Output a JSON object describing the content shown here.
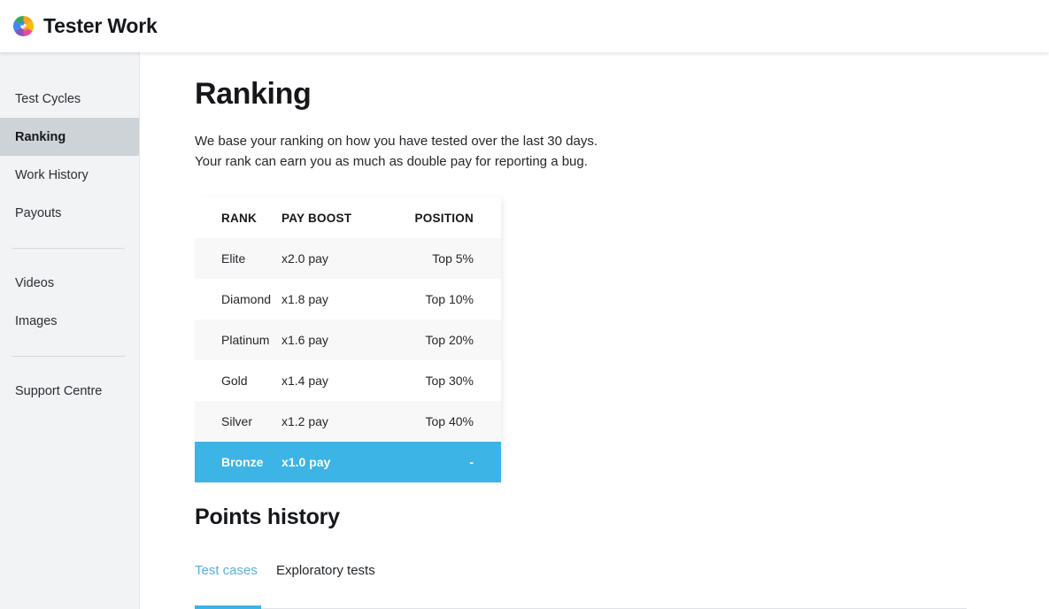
{
  "header": {
    "brand_name": "Tester Work",
    "logo_icon": "pinwheel-logo-icon",
    "logo_colors": [
      "#4285f4",
      "#34a853",
      "#fbbc05",
      "#f5a623",
      "#ea4335",
      "#7e57c2",
      "#ec4899",
      "#00acc1"
    ]
  },
  "sidebar": {
    "primary_items": [
      {
        "label": "Test Cycles",
        "active": false
      },
      {
        "label": "Ranking",
        "active": true
      },
      {
        "label": "Work History",
        "active": false
      },
      {
        "label": "Payouts",
        "active": false
      }
    ],
    "media_items": [
      {
        "label": "Videos",
        "active": false
      },
      {
        "label": "Images",
        "active": false
      }
    ],
    "support_items": [
      {
        "label": "Support Centre",
        "active": false
      }
    ],
    "active_bg": "#ced3d8"
  },
  "main": {
    "page_title": "Ranking",
    "intro_line_1": "We base your ranking on how you have tested over the last 30 days.",
    "intro_line_2": "Your rank can earn you as much as double pay for reporting a bug.",
    "rank_table": {
      "columns": [
        "RANK",
        "PAY BOOST",
        "POSITION"
      ],
      "rows": [
        {
          "rank": "Elite",
          "pay_boost": "x2.0 pay",
          "position": "Top 5%",
          "current": false
        },
        {
          "rank": "Diamond",
          "pay_boost": "x1.8 pay",
          "position": "Top 10%",
          "current": false
        },
        {
          "rank": "Platinum",
          "pay_boost": "x1.6 pay",
          "position": "Top 20%",
          "current": false
        },
        {
          "rank": "Gold",
          "pay_boost": "x1.4 pay",
          "position": "Top 30%",
          "current": false
        },
        {
          "rank": "Silver",
          "pay_boost": "x1.2 pay",
          "position": "Top 40%",
          "current": false
        },
        {
          "rank": "Bronze",
          "pay_boost": "x1.0 pay",
          "position": "-",
          "current": true
        }
      ],
      "highlight_color": "#3cb4e5"
    },
    "points_history": {
      "title": "Points history",
      "tabs": [
        {
          "label": "Test cases",
          "active": true
        },
        {
          "label": "Exploratory tests",
          "active": false
        }
      ],
      "active_tab_color": "#5aaedd",
      "underline_color": "#3cb4e5"
    }
  }
}
